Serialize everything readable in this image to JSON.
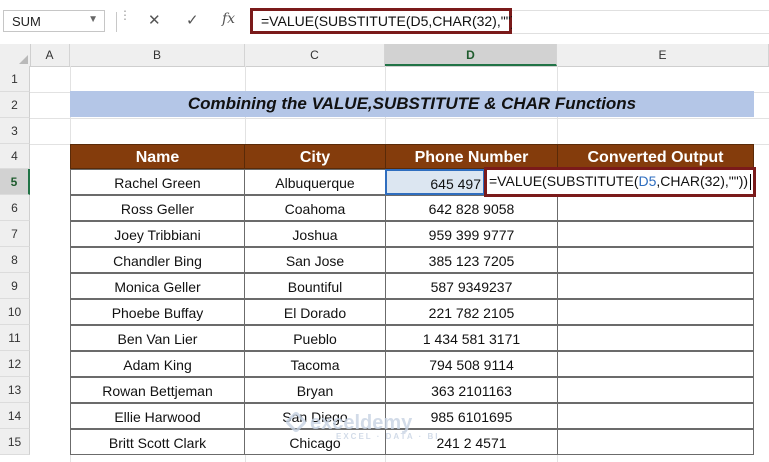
{
  "formula_bar": {
    "name_box": "SUM",
    "cancel_icon": "✕",
    "enter_icon": "✓",
    "fx_label": "fx",
    "formula": "=VALUE(SUBSTITUTE(D5,CHAR(32),\"\"))"
  },
  "columns": [
    "A",
    "B",
    "C",
    "D",
    "E"
  ],
  "rows": [
    "1",
    "2",
    "3",
    "4",
    "5",
    "6",
    "7",
    "8",
    "9",
    "10",
    "11",
    "12",
    "13",
    "14",
    "15"
  ],
  "title": "Combining the VALUE,SUBSTITUTE & CHAR Functions",
  "table": {
    "headers": [
      "Name",
      "City",
      "Phone Number",
      "Converted Output"
    ],
    "rows": [
      {
        "name": "Rachel Green",
        "city": "Albuquerque",
        "phone": "645 497"
      },
      {
        "name": "Ross Geller",
        "city": "Coahoma",
        "phone": "642 828 9058"
      },
      {
        "name": "Joey Tribbiani",
        "city": "Joshua",
        "phone": "959 399 9777"
      },
      {
        "name": "Chandler Bing",
        "city": "San Jose",
        "phone": "385 123 7205"
      },
      {
        "name": "Monica Geller",
        "city": "Bountiful",
        "phone": "587 9349237"
      },
      {
        "name": "Phoebe Buffay",
        "city": "El Dorado",
        "phone": "221 782 2105"
      },
      {
        "name": "Ben Van Lier",
        "city": "Pueblo",
        "phone": "1 434 581 3171"
      },
      {
        "name": "Adam King",
        "city": "Tacoma",
        "phone": "794 508 9114"
      },
      {
        "name": "Rowan Bettjeman",
        "city": "Bryan",
        "phone": "363 2101163"
      },
      {
        "name": "Ellie Harwood",
        "city": "San Diego",
        "phone": "985 6101695"
      },
      {
        "name": "Britt Scott Clark",
        "city": "Chicago",
        "phone": "241 2 4571"
      }
    ]
  },
  "edit_cell": {
    "prefix": "=VALUE(SUBSTITUTE(",
    "ref": "D5",
    "suffix": ",CHAR(32),\"\"))"
  },
  "watermark": {
    "brand": "exceldemy",
    "tagline": "EXCEL · DATA · BI"
  }
}
